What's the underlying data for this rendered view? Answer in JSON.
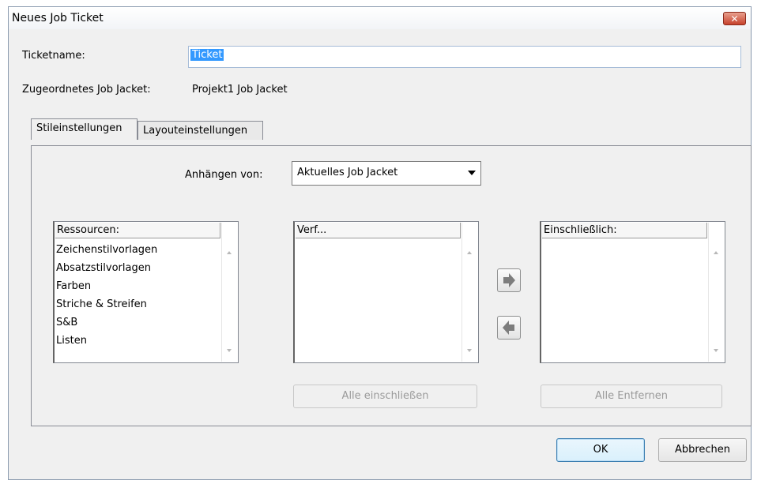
{
  "window": {
    "title": "Neues Job Ticket",
    "close_symbol": "✕"
  },
  "ticketname": {
    "label": "Ticketname:",
    "value": "Ticket"
  },
  "jacket": {
    "label": "Zugeordnetes Job Jacket:",
    "value": "Projekt1 Job Jacket"
  },
  "tabs": [
    {
      "label": "Stileinstellungen",
      "active": true
    },
    {
      "label": "Layouteinstellungen",
      "active": false
    }
  ],
  "append": {
    "label": "Anhängen von:",
    "selected": "Aktuelles Job Jacket"
  },
  "resources": {
    "header": "Ressourcen:",
    "items": [
      "Zeichenstilvorlagen",
      "Absatzstilvorlagen",
      "Farben",
      "Striche & Streifen",
      "S&B",
      "Listen"
    ]
  },
  "available": {
    "header": "Verf..."
  },
  "included": {
    "header": "Einschließlich:"
  },
  "buttons": {
    "include_all": "Alle einschließen",
    "remove_all": "Alle Entfernen",
    "ok": "OK",
    "cancel": "Abbrechen"
  },
  "colors": {
    "title_close": "#c7422d",
    "selection": "#3399ff",
    "arrow_icon": "#7d7d7d"
  }
}
